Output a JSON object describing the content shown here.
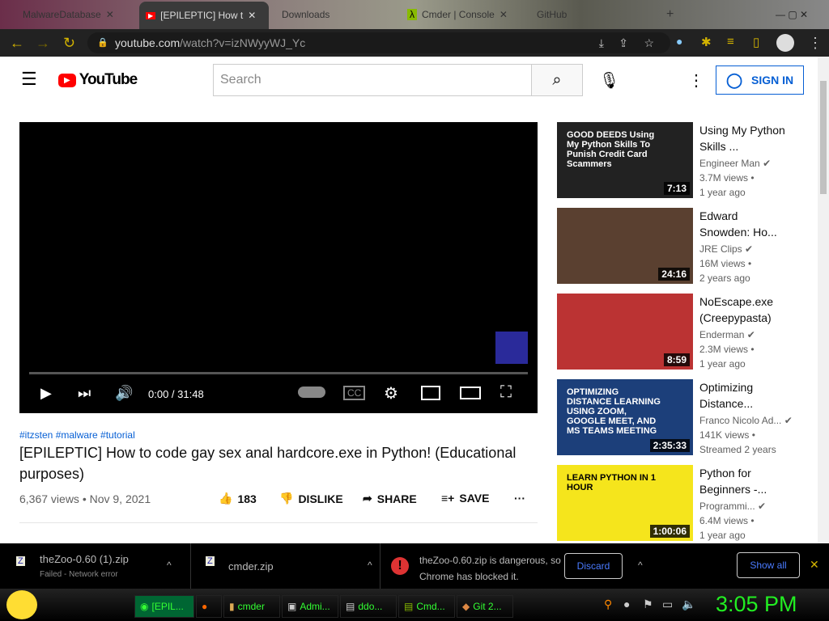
{
  "browser": {
    "tabs": [
      {
        "label": "MalwareDatabase"
      },
      {
        "label": "[EPILEPTIC] How t"
      },
      {
        "label": "Downloads"
      },
      {
        "label": "Cmder | Console"
      },
      {
        "label": "GitHub"
      }
    ],
    "url_domain": "youtube.com",
    "url_path": "/watch?v=izNWyyWJ_Yc"
  },
  "youtube": {
    "logo": "YouTube",
    "search_placeholder": "Search",
    "sign_in": "SIGN IN"
  },
  "player": {
    "time": "0:00 / 31:48",
    "progress": 0
  },
  "video": {
    "hashtags": "#itzsten #malware #tutorial",
    "title": "[EPILEPTIC] How to code gay sex anal hardcore.exe in Python! (Educational purposes)",
    "stats": "6,367 views • Nov 9, 2021",
    "likes": "183",
    "dislike": "DISLIKE",
    "share": "SHARE",
    "save": "SAVE"
  },
  "related": [
    {
      "title": "Using My Python Skills ...",
      "channel": "Engineer Man",
      "views": "3.7M views •",
      "age": "1 year ago",
      "duration": "7:13",
      "thumb_text": "GOOD DEEDS Using My Python Skills To Punish Credit Card Scammers",
      "color": "#222"
    },
    {
      "title": "Edward Snowden: Ho...",
      "channel": "JRE Clips",
      "views": "16M views •",
      "age": "2 years ago",
      "duration": "24:16",
      "thumb_text": "",
      "color": "#5a4030"
    },
    {
      "title": "NoEscape.exe (Creepypasta)",
      "channel": "Enderman",
      "views": "2.3M views •",
      "age": "1 year ago",
      "duration": "8:59",
      "thumb_text": "",
      "color": "#b33"
    },
    {
      "title": "Optimizing Distance...",
      "channel": "Franco Nicolo Ad...",
      "views": "141K views •",
      "age": "Streamed 2 years",
      "duration": "2:35:33",
      "thumb_text": "OPTIMIZING DISTANCE LEARNING USING ZOOM, GOOGLE MEET, AND MS TEAMS MEETING",
      "color": "#1c3f7a"
    },
    {
      "title": "Python for Beginners -...",
      "channel": "Programmi...",
      "views": "6.4M views •",
      "age": "1 year ago",
      "duration": "1:00:06",
      "thumb_text": "LEARN PYTHON IN 1 HOUR",
      "color": "#f5e51c"
    }
  ],
  "downloads": {
    "items": [
      {
        "name": "theZoo-0.60 (1).zip",
        "status": "Failed - Network error"
      },
      {
        "name": "cmder.zip"
      }
    ],
    "warning": "theZoo-0.60.zip is dangerous, so Chrome has blocked it.",
    "discard": "Discard",
    "show_all": "Show all"
  },
  "taskbar": {
    "items": [
      "[EPIL...",
      "",
      "cmder",
      "Admi...",
      "ddo...",
      "Cmd...",
      "Git 2..."
    ],
    "clock": "3:05 PM"
  }
}
